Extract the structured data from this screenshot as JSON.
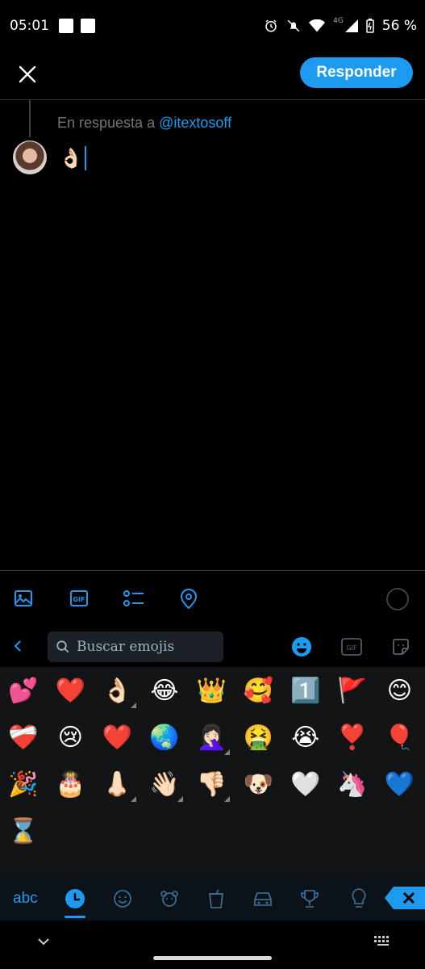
{
  "status_bar": {
    "time": "05:01",
    "network": "4G",
    "battery": "56 %"
  },
  "header": {
    "close_icon": "close-icon",
    "reply_button": "Responder"
  },
  "compose": {
    "reply_prefix": "En respuesta a",
    "reply_handle": "@itextosoff",
    "text": "👌🏻"
  },
  "toolbar": {
    "items": [
      "image-icon",
      "gif-icon",
      "poll-icon",
      "location-icon"
    ]
  },
  "keyboard": {
    "search_placeholder": "Buscar emojis",
    "tabs": [
      "emoji-tab",
      "gif-tab",
      "sticker-tab"
    ],
    "emojis": [
      {
        "char": "💕",
        "variant": false
      },
      {
        "char": "❤️",
        "variant": false
      },
      {
        "char": "👌🏻",
        "variant": true
      },
      {
        "char": "😂",
        "variant": false
      },
      {
        "char": "👑",
        "variant": false
      },
      {
        "char": "🥰",
        "variant": false
      },
      {
        "char": "1️⃣",
        "variant": false
      },
      {
        "char": "🚩",
        "variant": false
      },
      {
        "char": "😊",
        "variant": false
      },
      {
        "char": "❤️‍🩹",
        "variant": false
      },
      {
        "char": "😢",
        "variant": false
      },
      {
        "char": "❤️",
        "variant": false
      },
      {
        "char": "🌏",
        "variant": false
      },
      {
        "char": "🤦🏻‍♀️",
        "variant": true
      },
      {
        "char": "🤮",
        "variant": false
      },
      {
        "char": "😭",
        "variant": false
      },
      {
        "char": "❣️",
        "variant": false
      },
      {
        "char": "🎈",
        "variant": false
      },
      {
        "char": "🎉",
        "variant": false
      },
      {
        "char": "🎂",
        "variant": false
      },
      {
        "char": "👃🏻",
        "variant": true
      },
      {
        "char": "👋🏻",
        "variant": true
      },
      {
        "char": "👎🏻",
        "variant": true
      },
      {
        "char": "🐶",
        "variant": false
      },
      {
        "char": "🤍",
        "variant": false
      },
      {
        "char": "🦄",
        "variant": false
      },
      {
        "char": "💙",
        "variant": false
      },
      {
        "char": "⌛",
        "variant": false
      }
    ],
    "categories": {
      "abc_label": "abc",
      "icons": [
        "recent-icon",
        "smiley-icon",
        "animal-icon",
        "food-icon",
        "travel-icon",
        "activity-icon",
        "objects-icon"
      ]
    },
    "accent_color": "#1d9bf0"
  }
}
